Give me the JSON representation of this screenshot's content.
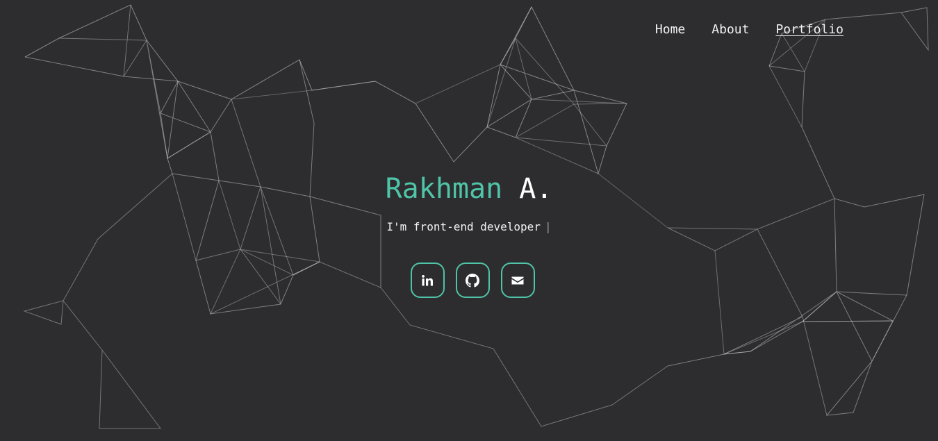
{
  "nav": {
    "items": [
      {
        "label": "Home"
      },
      {
        "label": "About"
      },
      {
        "label": "Portfolio",
        "active": true
      }
    ]
  },
  "hero": {
    "name_first": "Rakhman",
    "name_last": "A.",
    "subtitle": "I'm front-end developer",
    "cursor": "|"
  },
  "socials": [
    {
      "icon": "linkedin-icon"
    },
    {
      "icon": "github-icon"
    },
    {
      "icon": "mail-icon"
    }
  ],
  "colors": {
    "background": "#2d2d2f",
    "accent": "#4fc4a8",
    "text": "#f2f2f2",
    "network_lines": "#cfcfcf"
  }
}
